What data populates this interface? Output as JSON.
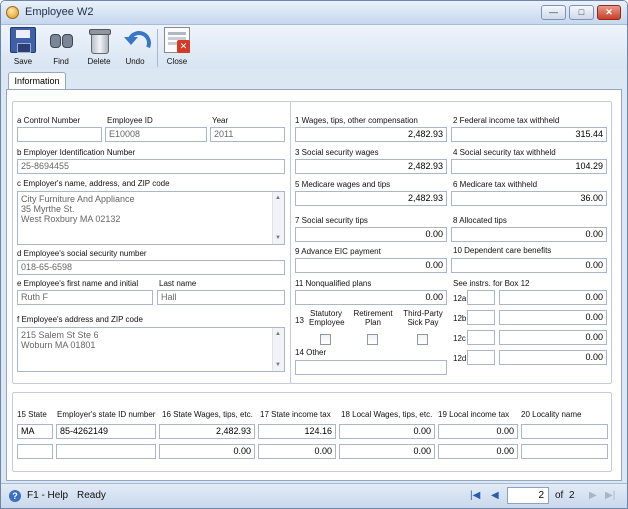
{
  "window": {
    "title": "Employee W2",
    "minimize": "—",
    "maximize": "□",
    "close": "✕"
  },
  "toolbar": {
    "save": "Save",
    "find": "Find",
    "delete": "Delete",
    "undo": "Undo",
    "close": "Close"
  },
  "tab": "Information",
  "employer": {
    "control_label": "a  Control Number",
    "control_value": "",
    "employee_id_label": "Employee ID",
    "employee_id_value": "E10008",
    "year_label": "Year",
    "year_value": "2011",
    "ein_label": "b  Employer Identification Number",
    "ein_value": "25-8694455",
    "address_label": "c  Employer's name, address, and ZIP code",
    "address_line1": "City Furniture And Appliance",
    "address_line2": "35 Myrthe St.",
    "address_line3": "West Roxbury MA 02132",
    "ssn_label": "d  Employee's social security number",
    "ssn_value": "018-65-6598",
    "first_name_label": "e  Employee's first name and initial",
    "first_name_value": "Ruth F",
    "last_name_label": "Last name",
    "last_name_value": "Hall",
    "emp_address_label": "f  Employee's address and ZIP code",
    "emp_address_line1": "215 Salem St Ste 6",
    "emp_address_line2": "Woburn MA 01801"
  },
  "boxes": {
    "b1_label": "1  Wages, tips, other compensation",
    "b1_value": "2,482.93",
    "b2_label": "2  Federal income tax withheld",
    "b2_value": "315.44",
    "b3_label": "3  Social security wages",
    "b3_value": "2,482.93",
    "b4_label": "4  Social security tax withheld",
    "b4_value": "104.29",
    "b5_label": "5  Medicare wages and tips",
    "b5_value": "2,482.93",
    "b6_label": "6  Medicare tax withheld",
    "b6_value": "36.00",
    "b7_label": "7  Social security tips",
    "b7_value": "0.00",
    "b8_label": "8  Allocated tips",
    "b8_value": "0.00",
    "b9_label": "9  Advance EIC payment",
    "b9_value": "0.00",
    "b10_label": "10  Dependent care benefits",
    "b10_value": "0.00",
    "b11_label": "11  Nonqualified plans",
    "b11_value": "0.00",
    "b12_label": "See instrs. for Box 12",
    "b12": [
      {
        "code_label": "12a",
        "code": "",
        "value": "0.00"
      },
      {
        "code_label": "12b",
        "code": "",
        "value": "0.00"
      },
      {
        "code_label": "12c",
        "code": "",
        "value": "0.00"
      },
      {
        "code_label": "12d",
        "code": "",
        "value": "0.00"
      }
    ],
    "b13_label": "13",
    "statutory_line1": "Statutory",
    "statutory_line2": "Employee",
    "retirement_line1": "Retirement",
    "retirement_line2": "Plan",
    "thirdparty_line1": "Third-Party",
    "thirdparty_line2": "Sick Pay",
    "b14_label": "14  Other",
    "b14_value": ""
  },
  "state": {
    "h15": "15  State",
    "h_stateid": "Employer's state ID number",
    "h16": "16  State Wages, tips, etc.",
    "h17": "17  State income tax",
    "h18": "18  Local Wages, tips, etc.",
    "h19": "19  Local income tax",
    "h20": "20  Locality name",
    "rows": [
      {
        "state": "MA",
        "id": "85-4262149",
        "wages": "2,482.93",
        "tax": "124.16",
        "local_wages": "0.00",
        "local_tax": "0.00",
        "locality": ""
      },
      {
        "state": "",
        "id": "",
        "wages": "0.00",
        "tax": "0.00",
        "local_wages": "0.00",
        "local_tax": "0.00",
        "locality": ""
      }
    ]
  },
  "status": {
    "help": "F1 - Help",
    "ready": "Ready",
    "page": "2",
    "of": "of",
    "total": "2"
  },
  "icons": [
    "app-icon",
    "save-icon",
    "find-icon",
    "delete-icon",
    "undo-icon",
    "close-icon",
    "help-icon",
    "first-page-icon",
    "prev-page-icon",
    "next-page-icon",
    "last-page-icon"
  ]
}
